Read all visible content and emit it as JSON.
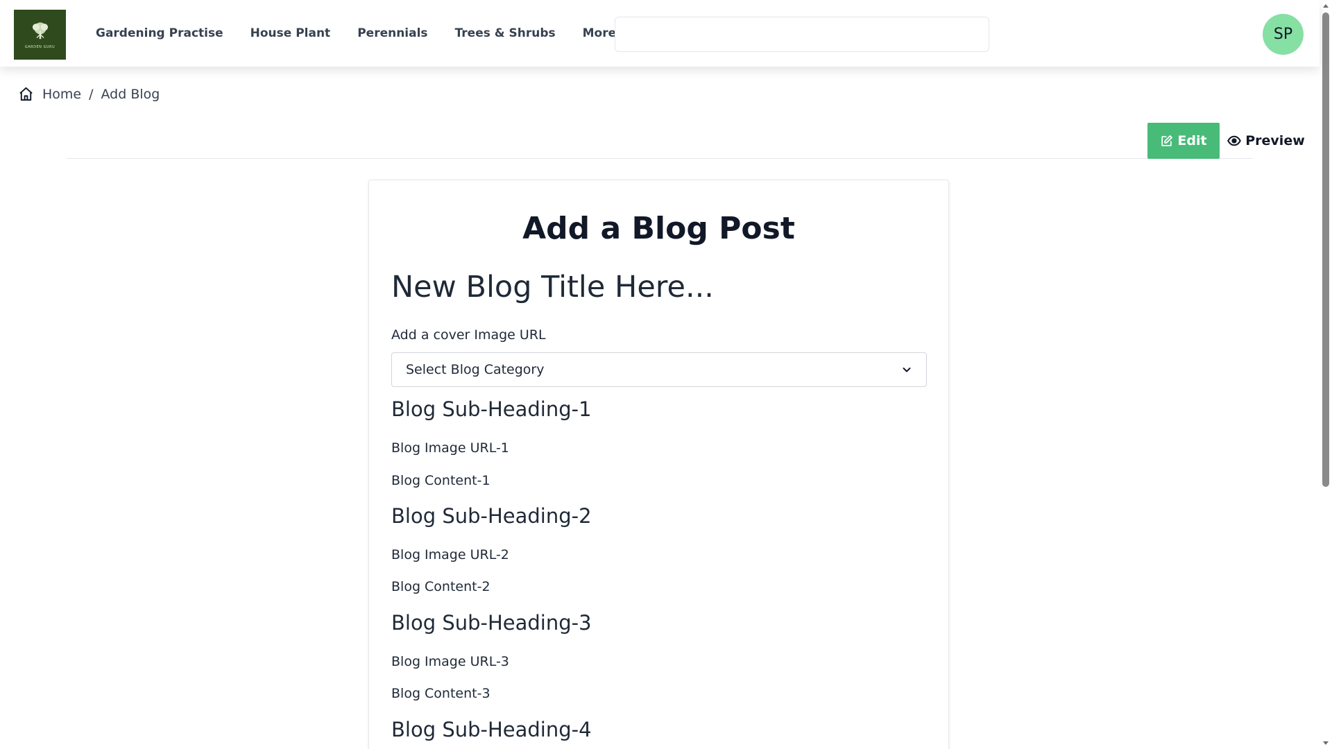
{
  "nav": {
    "logo_text": "GARDEN GURU",
    "links": [
      "Gardening Practise",
      "House Plant",
      "Perennials",
      "Trees & Shrubs",
      "More Plants"
    ],
    "search_value": "",
    "avatar_initials": "SP",
    "avatar_color": "#86e0a3"
  },
  "breadcrumb": {
    "home": "Home",
    "separator": "/",
    "current": "Add Blog"
  },
  "modes": {
    "edit_label": "Edit",
    "preview_label": "Preview",
    "accent_color": "#48bb78"
  },
  "form": {
    "heading": "Add a Blog Post",
    "title_placeholder": "New Blog Title Here...",
    "cover_placeholder": "Add a cover Image URL",
    "category_selected": "Select Blog Category",
    "sections": [
      {
        "heading": "Blog Sub-Heading-1",
        "image": "Blog Image URL-1",
        "content": "Blog Content-1"
      },
      {
        "heading": "Blog Sub-Heading-2",
        "image": "Blog Image URL-2",
        "content": "Blog Content-2"
      },
      {
        "heading": "Blog Sub-Heading-3",
        "image": "Blog Image URL-3",
        "content": "Blog Content-3"
      },
      {
        "heading": "Blog Sub-Heading-4"
      }
    ]
  }
}
